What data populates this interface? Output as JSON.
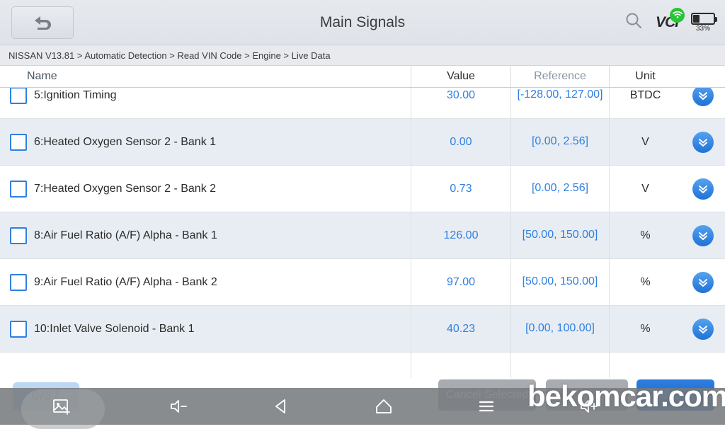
{
  "header": {
    "title": "Main Signals",
    "back_icon": "back-arrow-icon",
    "search_icon": "search-icon",
    "vci_label": "VCI",
    "wifi_icon": "wifi-icon",
    "battery_percent": "33%",
    "battery_level": 33
  },
  "breadcrumb": {
    "text": "NISSAN V13.81 > Automatic Detection  > Read VIN Code  > Engine > Live Data"
  },
  "table": {
    "columns": {
      "name": "Name",
      "value": "Value",
      "reference": "Reference",
      "unit": "Unit"
    },
    "rows": [
      {
        "label": "5:Ignition Timing",
        "value": "30.00",
        "reference": "[-128.00, 127.00]",
        "unit": "BTDC",
        "checked": false
      },
      {
        "label": "6:Heated Oxygen Sensor 2 - Bank 1",
        "value": "0.00",
        "reference": "[0.00, 2.56]",
        "unit": "V",
        "checked": false
      },
      {
        "label": "7:Heated Oxygen Sensor 2 - Bank 2",
        "value": "0.73",
        "reference": "[0.00, 2.56]",
        "unit": "V",
        "checked": false
      },
      {
        "label": "8:Air Fuel Ratio (A/F) Alpha - Bank 1",
        "value": "126.00",
        "reference": "[50.00, 150.00]",
        "unit": "%",
        "checked": false
      },
      {
        "label": "9:Air Fuel Ratio (A/F) Alpha - Bank 2",
        "value": "97.00",
        "reference": "[50.00, 150.00]",
        "unit": "%",
        "checked": false
      },
      {
        "label": "10:Inlet Valve Solenoid - Bank 1",
        "value": "40.23",
        "reference": "[0.00, 100.00]",
        "unit": "%",
        "checked": false
      }
    ],
    "expand_icon": "chevron-double-down-icon"
  },
  "actions": {
    "selected_count": "0/37",
    "cancel_selected_label": "Cancel Selected",
    "middle_button_label": "",
    "record_button_label": ""
  },
  "navbar": {
    "screenshot_icon": "screenshot-icon",
    "volume_down_icon": "volume-down-icon",
    "back_icon": "triangle-back-icon",
    "home_icon": "home-icon",
    "menu_icon": "hamburger-menu-icon",
    "volume_up_icon": "volume-up-icon"
  },
  "watermark": {
    "text": "bekomcar.com"
  }
}
